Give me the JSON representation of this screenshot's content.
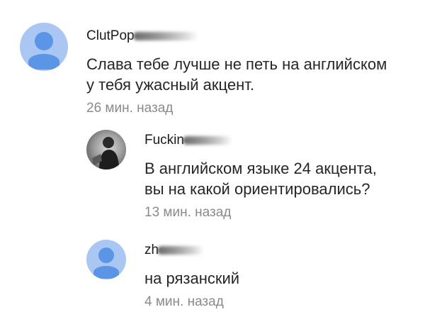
{
  "comments": [
    {
      "author": "ClutPop",
      "author_obscured": true,
      "avatar": "default-user-icon",
      "lines": [
        "Слава тебе лучше не петь на английском",
        "у тебя ужасный акцент."
      ],
      "time": "26 мин. назад"
    },
    {
      "author": "Fuckin",
      "author_obscured": true,
      "avatar": "user-photo",
      "lines": [
        "В английском языке 24 акцента,",
        "вы на какой ориентировались?"
      ],
      "time": "13 мин. назад"
    },
    {
      "author": "zh",
      "author_obscured": true,
      "avatar": "default-user-icon",
      "lines": [
        "на рязанский"
      ],
      "time": "4 мин. назад"
    }
  ],
  "colors": {
    "avatar_bg": "#a9c7f2",
    "avatar_fg": "#5b95e6",
    "text": "#262626",
    "time": "#8a8a8a"
  }
}
